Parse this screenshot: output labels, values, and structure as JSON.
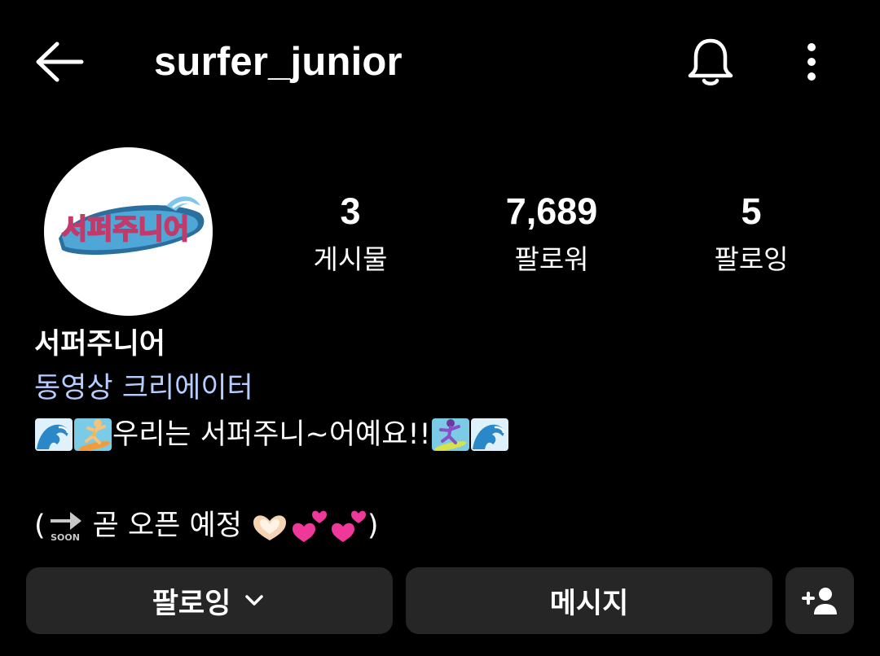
{
  "header": {
    "username": "surfer_junior",
    "icons": [
      "back-arrow-icon",
      "bell-icon",
      "more-vertical-icon"
    ]
  },
  "profile": {
    "avatar_text": "서퍼주니어",
    "stats": [
      {
        "value": "3",
        "label": "게시물"
      },
      {
        "value": "7,689",
        "label": "팔로워"
      },
      {
        "value": "5",
        "label": "팔로잉"
      }
    ]
  },
  "bio": {
    "name": "서퍼주니어",
    "category": "동영상 크리에이터",
    "line1": "우리는 서퍼주니~어예요!!",
    "line2_open": "(",
    "line2_text": "곧 오픈 예정",
    "line2_close": ")",
    "soon_badge": "SOON"
  },
  "actions": {
    "follow_label": "팔로잉",
    "message_label": "메시지"
  },
  "colors": {
    "background": "#000000",
    "button": "#262626",
    "category": "#b6cdff"
  }
}
